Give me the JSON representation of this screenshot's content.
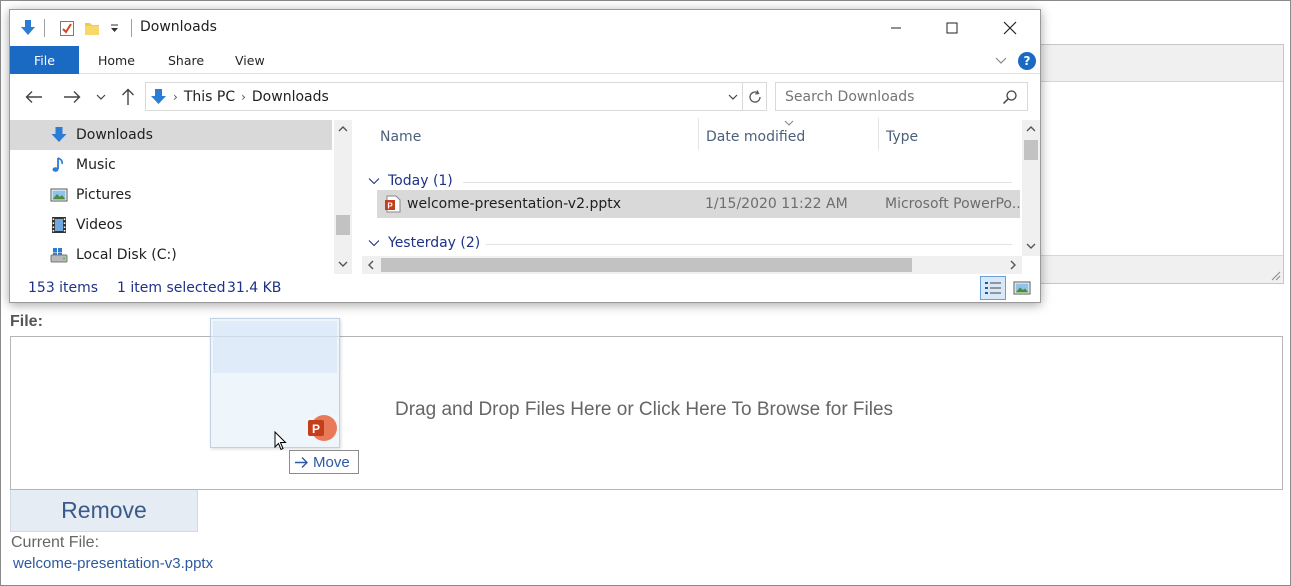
{
  "webpage": {
    "file_label": "File:",
    "dropzone_text": "Drag and Drop Files Here or Click Here To Browse for Files",
    "remove_label": "Remove",
    "current_file_label": "Current File:",
    "current_file_name": "welcome-presentation-v3.pptx"
  },
  "drag": {
    "move_label": "Move",
    "badge_letter": "P"
  },
  "explorer": {
    "title": "Downloads",
    "ribbon_tabs": [
      "File",
      "Home",
      "Share",
      "View"
    ],
    "help_label": "?",
    "breadcrumb": [
      "This PC",
      "Downloads"
    ],
    "search_placeholder": "Search Downloads",
    "nav_items": [
      {
        "label": "Downloads",
        "icon": "downloads-icon",
        "selected": true
      },
      {
        "label": "Music",
        "icon": "music-icon"
      },
      {
        "label": "Pictures",
        "icon": "pictures-icon"
      },
      {
        "label": "Videos",
        "icon": "videos-icon"
      },
      {
        "label": "Local Disk (C:)",
        "icon": "local-disk-icon"
      }
    ],
    "columns": [
      "Name",
      "Date modified",
      "Type"
    ],
    "groups": [
      {
        "label": "Today (1)"
      },
      {
        "label": "Yesterday (2)"
      }
    ],
    "files": [
      {
        "name": "welcome-presentation-v2.pptx",
        "date": "1/15/2020 11:22 AM",
        "type": "Microsoft PowerPo..."
      }
    ],
    "status": {
      "items_count": "153 items",
      "selection": "1 item selected",
      "size": "31.4 KB"
    }
  },
  "colors": {
    "accent_blue": "#1a6ac4",
    "link_blue": "#2c5aa0",
    "selection_gray": "#d9d9d9",
    "powerpoint_orange": "#d24726"
  }
}
